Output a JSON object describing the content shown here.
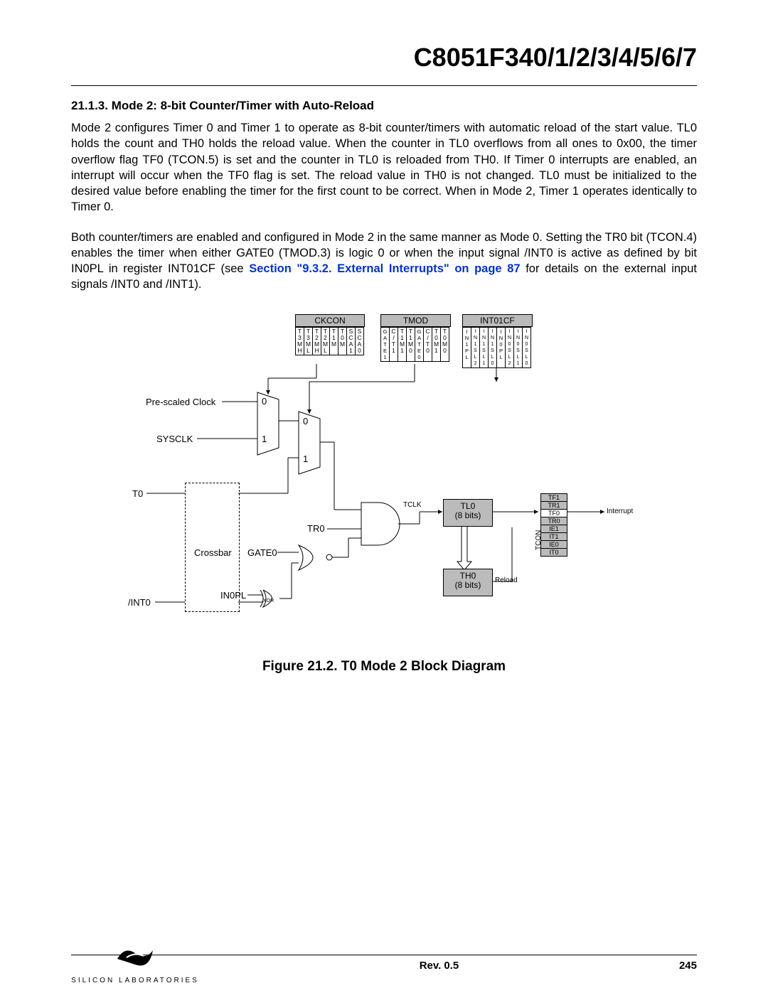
{
  "header": {
    "chip": "C8051F340/1/2/3/4/5/6/7"
  },
  "section": {
    "number": "21.1.3.",
    "title": "Mode 2: 8-bit Counter/Timer with Auto-Reload"
  },
  "paragraphs": {
    "p1": "Mode 2 configures Timer 0 and Timer 1 to operate as 8-bit counter/timers with automatic reload of the start value. TL0 holds the count and TH0 holds the reload value. When the counter in TL0 overflows from all ones to 0x00, the timer overflow flag TF0 (TCON.5) is set and the counter in TL0 is reloaded from TH0. If Timer 0 interrupts are enabled, an interrupt will occur when the TF0 flag is set. The reload value in TH0 is not changed. TL0 must be initialized to the desired value before enabling the timer for the first count to be correct. When in Mode 2, Timer 1 operates identically to Timer 0.",
    "p2a": "Both counter/timers are enabled and configured in Mode 2 in the same manner as Mode 0. Setting the TR0 bit (TCON.4) enables the timer when either GATE0 (TMOD.3) is logic 0 or when the input signal /INT0 is active as defined by bit IN0PL in register INT01CF (see ",
    "p2link": "Section \"9.3.2. External Interrupts\" on page 87",
    "p2b": " for details on the external input signals /INT0 and /INT1)."
  },
  "figure": {
    "caption": "Figure 21.2. T0 Mode 2 Block Diagram"
  },
  "diagram": {
    "regs": {
      "ckcon": {
        "title": "CKCON",
        "bits": [
          "T3MH",
          "T3ML",
          "T2MH",
          "T2ML",
          "T1M",
          "T0M",
          "SCA1",
          "SCA0"
        ]
      },
      "tmod": {
        "title": "TMOD",
        "bits": [
          "GATE1",
          "C/T1",
          "T1M1",
          "T1M0",
          "GATE0",
          "C/T0",
          "T0M1",
          "T0M0"
        ]
      },
      "int01cf": {
        "title": "INT01CF",
        "bits": [
          "IN1PL",
          "IN1SL2",
          "IN1SL1",
          "IN1SL0",
          "IN0PL",
          "IN0SL2",
          "IN0SL1",
          "IN0SL0"
        ]
      }
    },
    "labels": {
      "prescaled": "Pre-scaled Clock",
      "sysclk": "SYSCLK",
      "t0": "T0",
      "crossbar": "Crossbar",
      "int0": "/INT0",
      "gate0": "GATE0",
      "in0pl": "IN0PL",
      "tr0": "TR0",
      "tclk": "TCLK",
      "tl0": "TL0",
      "tl0sub": "(8 bits)",
      "th0": "TH0",
      "th0sub": "(8 bits)",
      "reload": "Reload",
      "interrupt": "Interrupt",
      "mux_top_0": "0",
      "mux_top_1": "1",
      "mux_bot_0": "0",
      "mux_bot_1": "1",
      "xor": "XOR"
    },
    "tcon": {
      "title": "TCON",
      "rows": [
        "TF1",
        "TR1",
        "TF0",
        "TR0",
        "IE1",
        "IT1",
        "IE0",
        "IT0"
      ]
    }
  },
  "footer": {
    "rev": "Rev. 0.5",
    "page": "245",
    "company": "SILICON LABORATORIES"
  }
}
